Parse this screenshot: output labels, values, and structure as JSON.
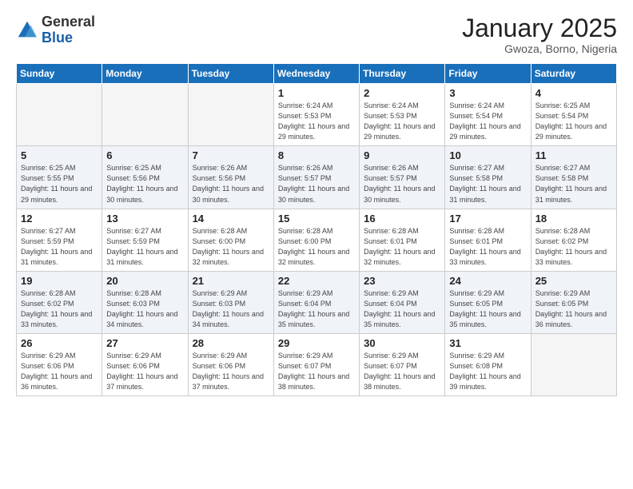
{
  "logo": {
    "general": "General",
    "blue": "Blue"
  },
  "header": {
    "month": "January 2025",
    "location": "Gwoza, Borno, Nigeria"
  },
  "weekdays": [
    "Sunday",
    "Monday",
    "Tuesday",
    "Wednesday",
    "Thursday",
    "Friday",
    "Saturday"
  ],
  "weeks": [
    [
      {
        "day": "",
        "info": ""
      },
      {
        "day": "",
        "info": ""
      },
      {
        "day": "",
        "info": ""
      },
      {
        "day": "1",
        "info": "Sunrise: 6:24 AM\nSunset: 5:53 PM\nDaylight: 11 hours and 29 minutes."
      },
      {
        "day": "2",
        "info": "Sunrise: 6:24 AM\nSunset: 5:53 PM\nDaylight: 11 hours and 29 minutes."
      },
      {
        "day": "3",
        "info": "Sunrise: 6:24 AM\nSunset: 5:54 PM\nDaylight: 11 hours and 29 minutes."
      },
      {
        "day": "4",
        "info": "Sunrise: 6:25 AM\nSunset: 5:54 PM\nDaylight: 11 hours and 29 minutes."
      }
    ],
    [
      {
        "day": "5",
        "info": "Sunrise: 6:25 AM\nSunset: 5:55 PM\nDaylight: 11 hours and 29 minutes."
      },
      {
        "day": "6",
        "info": "Sunrise: 6:25 AM\nSunset: 5:56 PM\nDaylight: 11 hours and 30 minutes."
      },
      {
        "day": "7",
        "info": "Sunrise: 6:26 AM\nSunset: 5:56 PM\nDaylight: 11 hours and 30 minutes."
      },
      {
        "day": "8",
        "info": "Sunrise: 6:26 AM\nSunset: 5:57 PM\nDaylight: 11 hours and 30 minutes."
      },
      {
        "day": "9",
        "info": "Sunrise: 6:26 AM\nSunset: 5:57 PM\nDaylight: 11 hours and 30 minutes."
      },
      {
        "day": "10",
        "info": "Sunrise: 6:27 AM\nSunset: 5:58 PM\nDaylight: 11 hours and 31 minutes."
      },
      {
        "day": "11",
        "info": "Sunrise: 6:27 AM\nSunset: 5:58 PM\nDaylight: 11 hours and 31 minutes."
      }
    ],
    [
      {
        "day": "12",
        "info": "Sunrise: 6:27 AM\nSunset: 5:59 PM\nDaylight: 11 hours and 31 minutes."
      },
      {
        "day": "13",
        "info": "Sunrise: 6:27 AM\nSunset: 5:59 PM\nDaylight: 11 hours and 31 minutes."
      },
      {
        "day": "14",
        "info": "Sunrise: 6:28 AM\nSunset: 6:00 PM\nDaylight: 11 hours and 32 minutes."
      },
      {
        "day": "15",
        "info": "Sunrise: 6:28 AM\nSunset: 6:00 PM\nDaylight: 11 hours and 32 minutes."
      },
      {
        "day": "16",
        "info": "Sunrise: 6:28 AM\nSunset: 6:01 PM\nDaylight: 11 hours and 32 minutes."
      },
      {
        "day": "17",
        "info": "Sunrise: 6:28 AM\nSunset: 6:01 PM\nDaylight: 11 hours and 33 minutes."
      },
      {
        "day": "18",
        "info": "Sunrise: 6:28 AM\nSunset: 6:02 PM\nDaylight: 11 hours and 33 minutes."
      }
    ],
    [
      {
        "day": "19",
        "info": "Sunrise: 6:28 AM\nSunset: 6:02 PM\nDaylight: 11 hours and 33 minutes."
      },
      {
        "day": "20",
        "info": "Sunrise: 6:28 AM\nSunset: 6:03 PM\nDaylight: 11 hours and 34 minutes."
      },
      {
        "day": "21",
        "info": "Sunrise: 6:29 AM\nSunset: 6:03 PM\nDaylight: 11 hours and 34 minutes."
      },
      {
        "day": "22",
        "info": "Sunrise: 6:29 AM\nSunset: 6:04 PM\nDaylight: 11 hours and 35 minutes."
      },
      {
        "day": "23",
        "info": "Sunrise: 6:29 AM\nSunset: 6:04 PM\nDaylight: 11 hours and 35 minutes."
      },
      {
        "day": "24",
        "info": "Sunrise: 6:29 AM\nSunset: 6:05 PM\nDaylight: 11 hours and 35 minutes."
      },
      {
        "day": "25",
        "info": "Sunrise: 6:29 AM\nSunset: 6:05 PM\nDaylight: 11 hours and 36 minutes."
      }
    ],
    [
      {
        "day": "26",
        "info": "Sunrise: 6:29 AM\nSunset: 6:06 PM\nDaylight: 11 hours and 36 minutes."
      },
      {
        "day": "27",
        "info": "Sunrise: 6:29 AM\nSunset: 6:06 PM\nDaylight: 11 hours and 37 minutes."
      },
      {
        "day": "28",
        "info": "Sunrise: 6:29 AM\nSunset: 6:06 PM\nDaylight: 11 hours and 37 minutes."
      },
      {
        "day": "29",
        "info": "Sunrise: 6:29 AM\nSunset: 6:07 PM\nDaylight: 11 hours and 38 minutes."
      },
      {
        "day": "30",
        "info": "Sunrise: 6:29 AM\nSunset: 6:07 PM\nDaylight: 11 hours and 38 minutes."
      },
      {
        "day": "31",
        "info": "Sunrise: 6:29 AM\nSunset: 6:08 PM\nDaylight: 11 hours and 39 minutes."
      },
      {
        "day": "",
        "info": ""
      }
    ]
  ]
}
